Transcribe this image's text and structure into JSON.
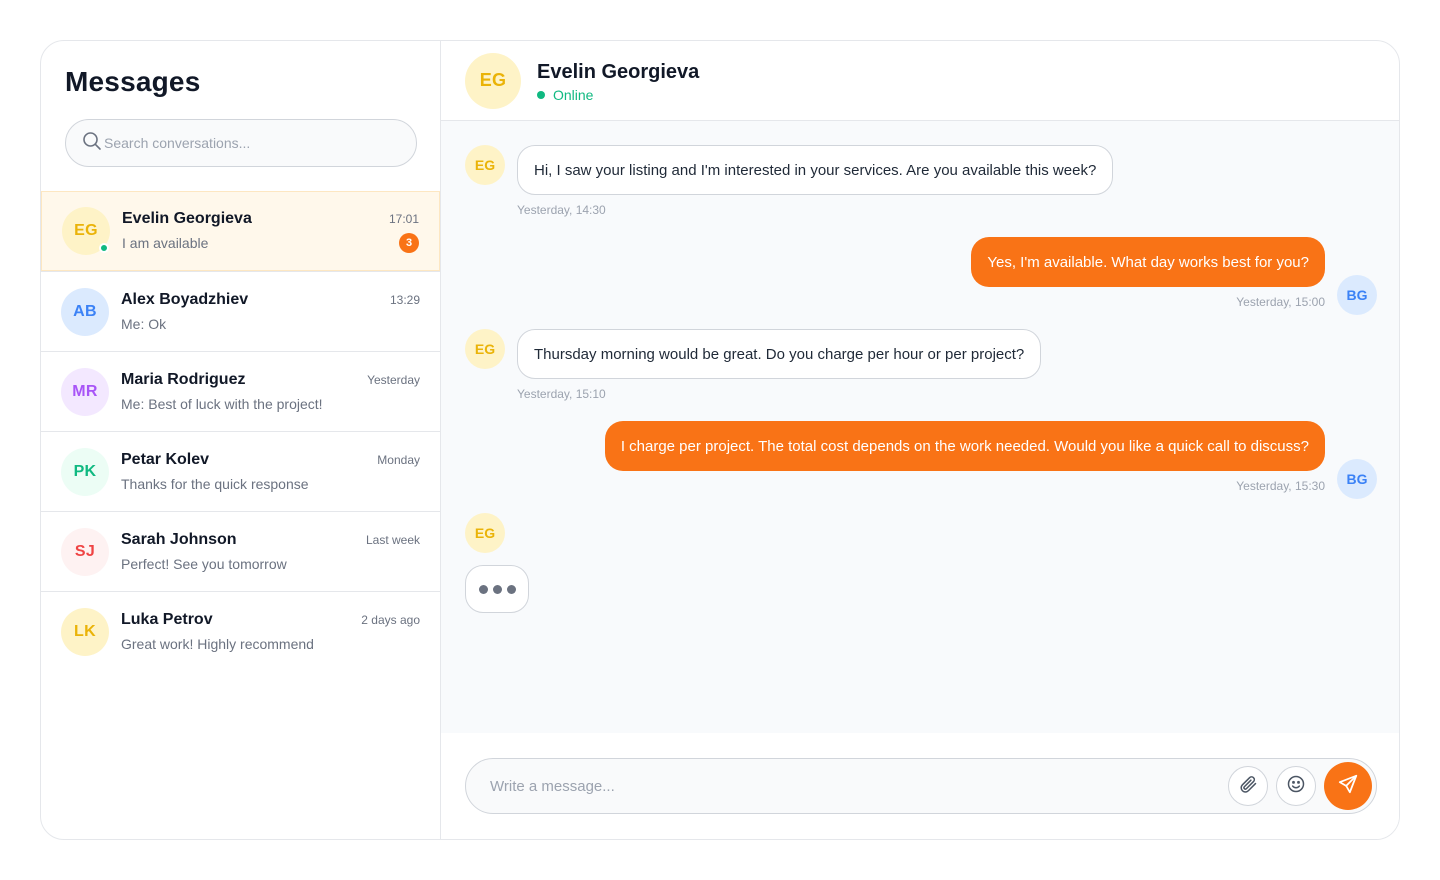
{
  "sidebar": {
    "title": "Messages",
    "search_placeholder": "Search conversations...",
    "conversations": [
      {
        "initials": "EG",
        "name": "Evelin Georgieva",
        "time": "17:01",
        "preview": "I am available",
        "unread": "3",
        "online": true,
        "avatar_bg": "#fef3c7",
        "avatar_fg": "#eab308",
        "active": true
      },
      {
        "initials": "AB",
        "name": "Alex Boyadzhiev",
        "time": "13:29",
        "preview": "Me: Ok",
        "avatar_bg": "#dbeafe",
        "avatar_fg": "#3b82f6"
      },
      {
        "initials": "MR",
        "name": "Maria Rodriguez",
        "time": "Yesterday",
        "preview": "Me: Best of luck with the project!",
        "avatar_bg": "#f3e8ff",
        "avatar_fg": "#a855f7"
      },
      {
        "initials": "PK",
        "name": "Petar Kolev",
        "time": "Monday",
        "preview": "Thanks for the quick response",
        "avatar_bg": "#ecfdf5",
        "avatar_fg": "#10b981"
      },
      {
        "initials": "SJ",
        "name": "Sarah Johnson",
        "time": "Last week",
        "preview": "Perfect! See you tomorrow",
        "avatar_bg": "#fef2f2",
        "avatar_fg": "#ef4444"
      },
      {
        "initials": "LK",
        "name": "Luka Petrov",
        "time": "2 days ago",
        "preview": "Great work! Highly recommend",
        "avatar_bg": "#fef3c7",
        "avatar_fg": "#eab308"
      }
    ]
  },
  "chat": {
    "contact_initials": "EG",
    "contact_name": "Evelin Georgieva",
    "status": "Online",
    "me_initials": "BG",
    "messages": [
      {
        "dir": "in",
        "text": "Hi, I saw your listing and I'm interested in your services. Are you available this week?",
        "time": "Yesterday, 14:30"
      },
      {
        "dir": "out",
        "text": "Yes, I'm available. What day works best for you?",
        "time": "Yesterday, 15:00"
      },
      {
        "dir": "in",
        "text": "Thursday morning would be great. Do you charge per hour or per project?",
        "time": "Yesterday, 15:10"
      },
      {
        "dir": "out",
        "text": "I charge per project. The total cost depends on the work needed. Would you like a quick call to discuss?",
        "time": "Yesterday, 15:30"
      }
    ],
    "composer_placeholder": "Write a message..."
  },
  "colors": {
    "accent": "#f97316",
    "online": "#10b981",
    "contact_avatar_bg": "#fef3c7",
    "contact_avatar_fg": "#eab308",
    "me_avatar_bg": "#dbeafe",
    "me_avatar_fg": "#3b82f6"
  },
  "icons": {
    "search": "search-icon",
    "attach": "paperclip-icon",
    "emoji": "smiley-icon",
    "send": "send-icon"
  }
}
